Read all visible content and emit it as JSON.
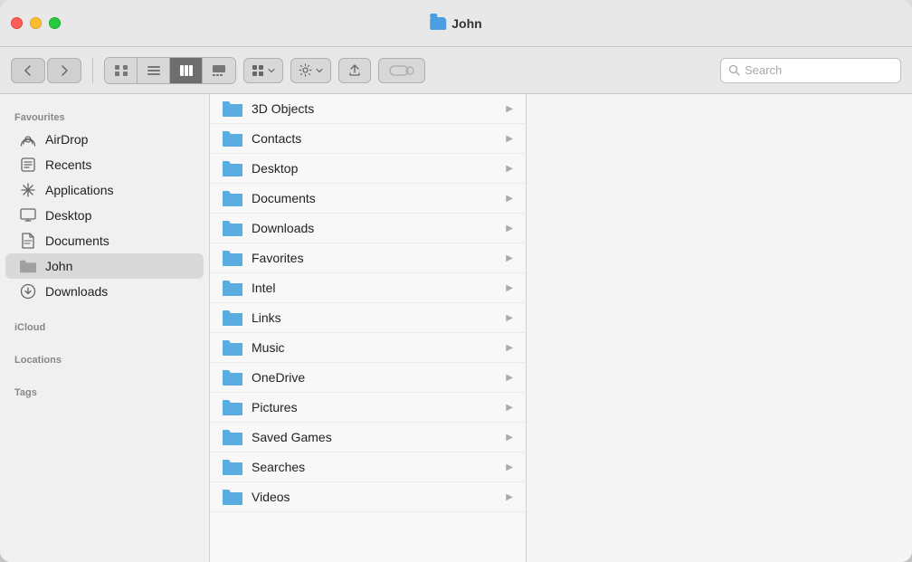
{
  "window": {
    "title": "John",
    "traffic_lights": {
      "close": "close",
      "minimize": "minimize",
      "maximize": "maximize"
    }
  },
  "toolbar": {
    "back_label": "‹",
    "forward_label": "›",
    "view_icons": [
      "icon-view",
      "list-view",
      "column-view",
      "gallery-view"
    ],
    "group_btn_label": "⊞",
    "action_btn_label": "⚙",
    "share_btn_label": "↑",
    "tag_btn_label": "⬡",
    "search_placeholder": "Search"
  },
  "sidebar": {
    "sections": [
      {
        "label": "Favourites",
        "items": [
          {
            "id": "airdrop",
            "label": "AirDrop",
            "icon": "airdrop"
          },
          {
            "id": "recents",
            "label": "Recents",
            "icon": "recents"
          },
          {
            "id": "applications",
            "label": "Applications",
            "icon": "applications"
          },
          {
            "id": "desktop",
            "label": "Desktop",
            "icon": "desktop"
          },
          {
            "id": "documents",
            "label": "Documents",
            "icon": "documents"
          },
          {
            "id": "john",
            "label": "John",
            "icon": "folder",
            "active": true
          },
          {
            "id": "downloads",
            "label": "Downloads",
            "icon": "downloads"
          }
        ]
      },
      {
        "label": "iCloud",
        "items": []
      },
      {
        "label": "Locations",
        "items": []
      },
      {
        "label": "Tags",
        "items": []
      }
    ]
  },
  "files": [
    {
      "name": "3D Objects",
      "has_children": true
    },
    {
      "name": "Contacts",
      "has_children": true
    },
    {
      "name": "Desktop",
      "has_children": true
    },
    {
      "name": "Documents",
      "has_children": true
    },
    {
      "name": "Downloads",
      "has_children": true
    },
    {
      "name": "Favorites",
      "has_children": true
    },
    {
      "name": "Intel",
      "has_children": true
    },
    {
      "name": "Links",
      "has_children": true
    },
    {
      "name": "Music",
      "has_children": true
    },
    {
      "name": "OneDrive",
      "has_children": true
    },
    {
      "name": "Pictures",
      "has_children": true
    },
    {
      "name": "Saved Games",
      "has_children": true
    },
    {
      "name": "Searches",
      "has_children": true
    },
    {
      "name": "Videos",
      "has_children": true
    }
  ],
  "colors": {
    "folder_blue": "#5aade0",
    "active_sidebar": "#d9d9d9",
    "chevron": "#aaaaaa"
  }
}
